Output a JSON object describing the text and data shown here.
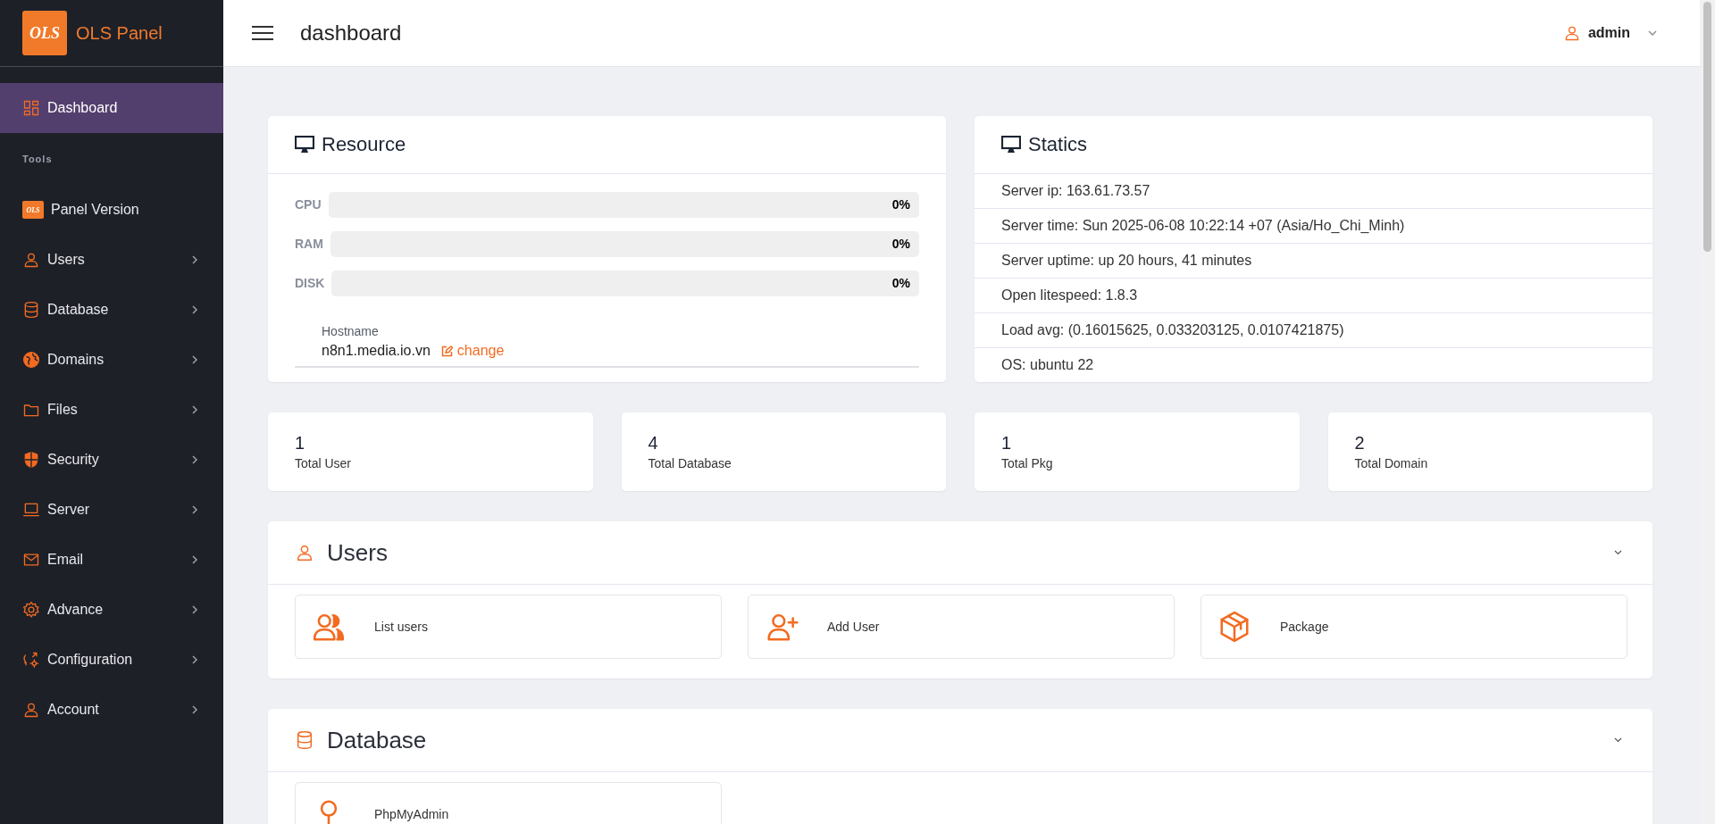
{
  "sidebar": {
    "logo": {
      "mark": "OLS",
      "title": "OLS Panel"
    },
    "items": [
      {
        "kind": "link",
        "label": "Dashboard",
        "selected": true,
        "expandable": false
      },
      {
        "kind": "heading",
        "label": "Tools"
      },
      {
        "kind": "link",
        "label": "Panel Version",
        "badge": "OLS",
        "selected": false,
        "expandable": false
      },
      {
        "kind": "link",
        "label": "Users",
        "selected": false,
        "expandable": true
      },
      {
        "kind": "link",
        "label": "Database",
        "selected": false,
        "expandable": true
      },
      {
        "kind": "link",
        "label": "Domains",
        "selected": false,
        "expandable": true
      },
      {
        "kind": "link",
        "label": "Files",
        "selected": false,
        "expandable": true
      },
      {
        "kind": "link",
        "label": "Security",
        "selected": false,
        "expandable": true
      },
      {
        "kind": "link",
        "label": "Server",
        "selected": false,
        "expandable": true
      },
      {
        "kind": "link",
        "label": "Email",
        "selected": false,
        "expandable": true
      },
      {
        "kind": "link",
        "label": "Advance",
        "selected": false,
        "expandable": true
      },
      {
        "kind": "link",
        "label": "Configuration",
        "selected": false,
        "expandable": true
      },
      {
        "kind": "link",
        "label": "Account",
        "selected": false,
        "expandable": true
      }
    ]
  },
  "header": {
    "title": "dashboard",
    "user": "admin"
  },
  "resource": {
    "title": "Resource",
    "meters": [
      {
        "label": "CPU",
        "level": 0,
        "reading": "0%"
      },
      {
        "label": "RAM",
        "level": 0,
        "reading": "0%"
      },
      {
        "label": "DISK",
        "level": 0,
        "reading": "0%"
      }
    ],
    "hostname_label": "Hostname",
    "hostname": "n8n1.media.io.vn",
    "change_link": "change"
  },
  "statics": {
    "title": "Statics",
    "rows": [
      "Server ip: 163.61.73.57",
      "Server time: Sun 2025-06-08 10:22:14 +07 (Asia/Ho_Chi_Minh)",
      "Server uptime: up 20 hours, 41 minutes",
      "Open litespeed: 1.8.3",
      "Load avg: (0.16015625, 0.033203125, 0.0107421875)",
      "OS: ubuntu 22"
    ]
  },
  "totals": [
    {
      "value": "1",
      "label": "Total User"
    },
    {
      "value": "4",
      "label": "Total Database"
    },
    {
      "value": "1",
      "label": "Total Pkg"
    },
    {
      "value": "2",
      "label": "Total Domain"
    }
  ],
  "sections": [
    {
      "title": "Users",
      "tiles": [
        "List users",
        "Add User",
        "Package"
      ]
    },
    {
      "title": "Database",
      "tiles": [
        "PhpMyAdmin"
      ]
    }
  ]
}
